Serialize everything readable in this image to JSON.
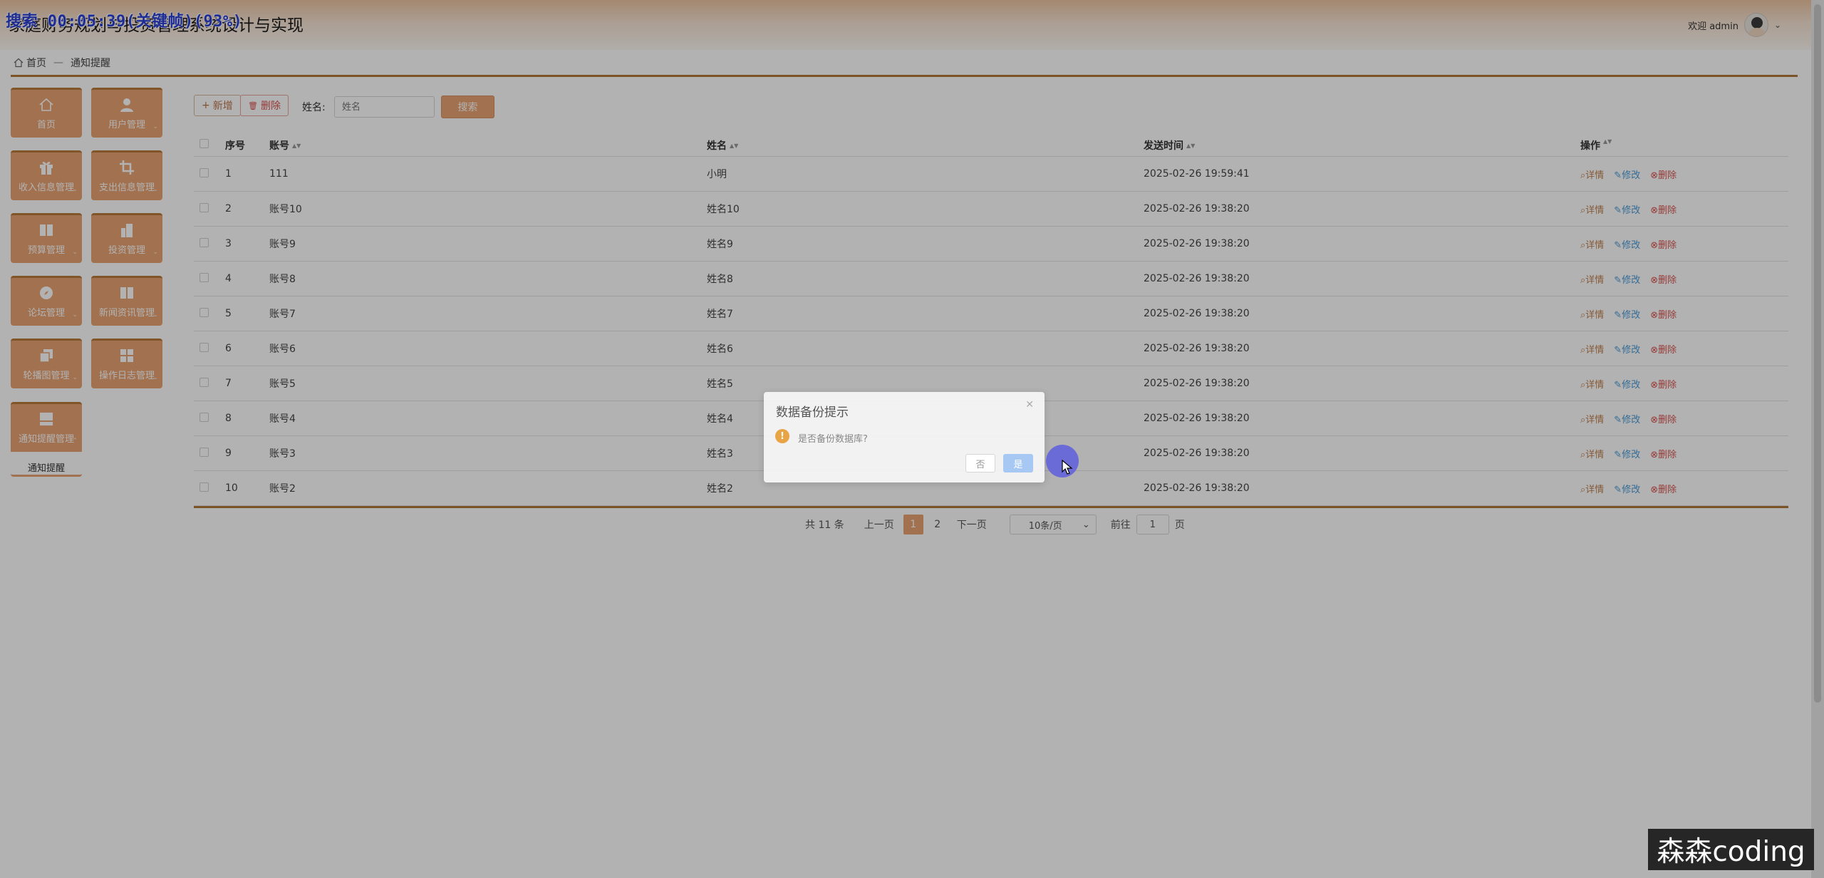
{
  "header": {
    "title": "家庭财务规划与投资管理系统设计与实现",
    "recorder_overlay": "搜索 00:05:39(关键帧)(93%)",
    "welcome": "欢迎 admin"
  },
  "breadcrumb": {
    "home": "首页",
    "current": "通知提醒"
  },
  "sidebar": {
    "tiles": [
      {
        "label": "首页",
        "icon": "home-icon"
      },
      {
        "label": "用户管理",
        "icon": "user-icon"
      },
      {
        "label": "收入信息管理",
        "icon": "gift-icon"
      },
      {
        "label": "支出信息管理",
        "icon": "crop-icon"
      },
      {
        "label": "预算管理",
        "icon": "book-icon"
      },
      {
        "label": "投资管理",
        "icon": "building-icon"
      },
      {
        "label": "论坛管理",
        "icon": "compass-icon"
      },
      {
        "label": "新闻资讯管理",
        "icon": "book-icon"
      },
      {
        "label": "轮播图管理",
        "icon": "copy-icon"
      },
      {
        "label": "操作日志管理",
        "icon": "grid-icon"
      },
      {
        "label": "通知提醒管理",
        "icon": "inbox-icon"
      }
    ],
    "submenu_item": "通知提醒"
  },
  "toolbar": {
    "add_label": "新增",
    "delete_label": "删除",
    "name_label": "姓名:",
    "name_placeholder": "姓名",
    "search_label": "搜索"
  },
  "table": {
    "headers": {
      "index": "序号",
      "account": "账号",
      "name": "姓名",
      "time": "发送时间",
      "ops": "操作"
    },
    "rows": [
      {
        "index": "1",
        "account": "111",
        "name": "小明",
        "time": "2025-02-26 19:59:41"
      },
      {
        "index": "2",
        "account": "账号10",
        "name": "姓名10",
        "time": "2025-02-26 19:38:20"
      },
      {
        "index": "3",
        "account": "账号9",
        "name": "姓名9",
        "time": "2025-02-26 19:38:20"
      },
      {
        "index": "4",
        "account": "账号8",
        "name": "姓名8",
        "time": "2025-02-26 19:38:20"
      },
      {
        "index": "5",
        "account": "账号7",
        "name": "姓名7",
        "time": "2025-02-26 19:38:20"
      },
      {
        "index": "6",
        "account": "账号6",
        "name": "姓名6",
        "time": "2025-02-26 19:38:20"
      },
      {
        "index": "7",
        "account": "账号5",
        "name": "姓名5",
        "time": "2025-02-26 19:38:20"
      },
      {
        "index": "8",
        "account": "账号4",
        "name": "姓名4",
        "time": "2025-02-26 19:38:20"
      },
      {
        "index": "9",
        "account": "账号3",
        "name": "姓名3",
        "time": "2025-02-26 19:38:20"
      },
      {
        "index": "10",
        "account": "账号2",
        "name": "姓名2",
        "time": "2025-02-26 19:38:20"
      }
    ],
    "op_detail": "详情",
    "op_edit": "修改",
    "op_delete": "删除"
  },
  "pagination": {
    "total": "共 11 条",
    "prev": "上一页",
    "pages": [
      "1",
      "2"
    ],
    "current_page": "1",
    "next": "下一页",
    "page_size": "10条/页",
    "goto_label": "前往",
    "goto_value": "1",
    "page_unit": "页"
  },
  "dialog": {
    "title": "数据备份提示",
    "message": "是否备份数据库?",
    "no_label": "否",
    "yes_label": "是"
  },
  "watermark": "森森coding",
  "colors": {
    "accent": "#e8a272",
    "border_brown": "#b07a3a",
    "edit_blue": "#4a9ad6",
    "delete_red": "#d9534f",
    "dialog_yes": "#a6c8f2"
  }
}
